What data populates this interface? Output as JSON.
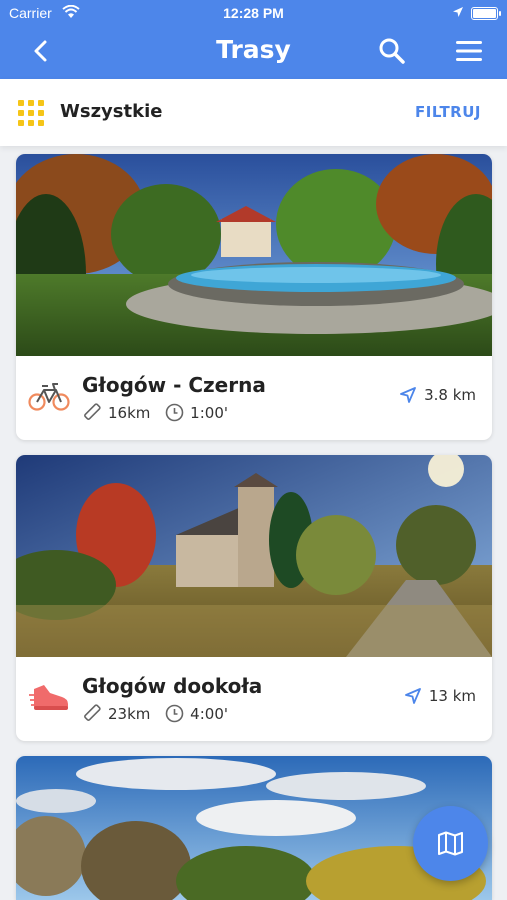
{
  "status": {
    "carrier": "Carrier",
    "time": "12:28 PM"
  },
  "nav": {
    "title": "Trasy"
  },
  "filter": {
    "label": "Wszystkie",
    "button": "FILTRUJ"
  },
  "routes": [
    {
      "title": "Głogów - Czerna",
      "length": "16km",
      "duration": "1:00'",
      "distance": "3.8 km",
      "activity": "bike-icon"
    },
    {
      "title": "Głogów dookoła",
      "length": "23km",
      "duration": "4:00'",
      "distance": "13 km",
      "activity": "walking-shoe-icon"
    }
  ],
  "colors": {
    "accent": "#4d86ea",
    "grid_icon": "#f5c518",
    "shoe": "#f06b6b",
    "bike": "#f08a5d"
  }
}
